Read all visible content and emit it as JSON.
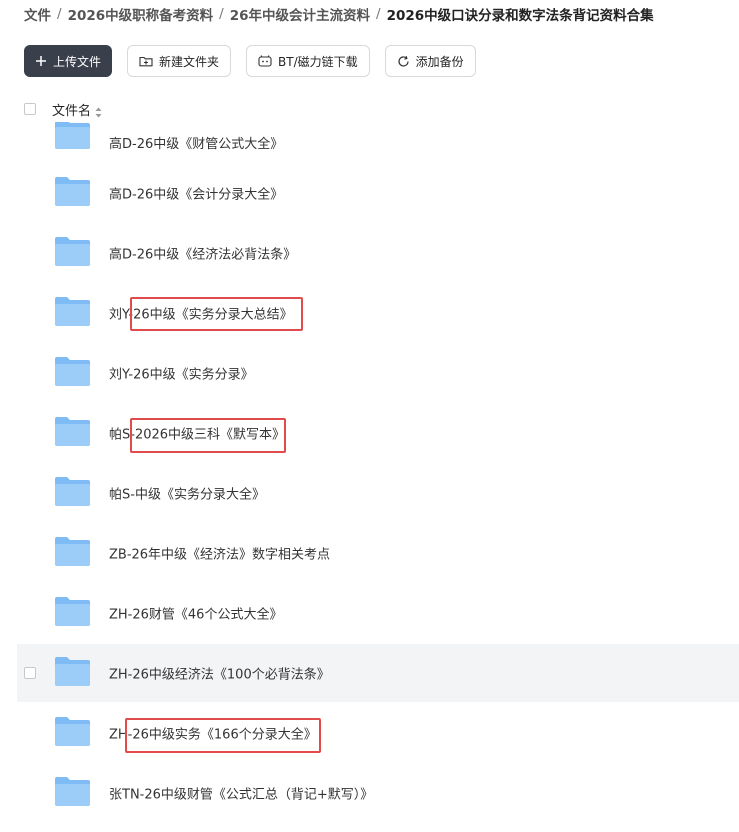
{
  "breadcrumb": [
    {
      "label": "文件"
    },
    {
      "label": "2026中级职称备考资料"
    },
    {
      "label": "26年中级会计主流资料"
    },
    {
      "label": "2026中级口诀分录和数字法条背记资料合集"
    }
  ],
  "toolbar": {
    "upload": "上传文件",
    "new_folder": "新建文件夹",
    "bt_download": "BT/磁力链下载",
    "add_backup": "添加备份"
  },
  "list_header": {
    "name_label": "文件名"
  },
  "files": [
    {
      "name": "高D-26中级《财管公式大全》"
    },
    {
      "name": "高D-26中级《会计分录大全》"
    },
    {
      "name": "高D-26中级《经济法必背法条》"
    },
    {
      "name": "刘Y-26中级《实务分录大总结》"
    },
    {
      "name": "刘Y-26中级《实务分录》"
    },
    {
      "name": "帕S-2026中级三科《默写本》"
    },
    {
      "name": "帕S-中级《实务分录大全》"
    },
    {
      "name": "ZB-26年中级《经济法》数字相关考点"
    },
    {
      "name": "ZH-26财管《46个公式大全》"
    },
    {
      "name": "ZH-26中级经济法《100个必背法条》"
    },
    {
      "name": "ZH-26中级实务《166个分录大全》"
    },
    {
      "name": "张TN-26中级财管《公式汇总（背记+默写）》"
    }
  ],
  "colors": {
    "primary_button": "#3a3f4c",
    "highlight_box": "#e04b4b",
    "hover_row": "#f3f4f6",
    "folder_blue": "#7fbcf5"
  }
}
